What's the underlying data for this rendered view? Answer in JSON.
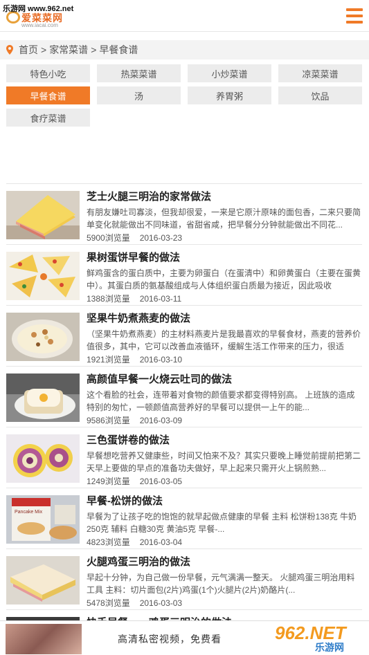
{
  "watermark": "乐游网 www.962.net",
  "logo": {
    "brand": "爱菜菜网",
    "domain": "www.iacai.com"
  },
  "breadcrumb": {
    "home": "首页",
    "sep1": ">",
    "level1": "家常菜谱",
    "sep2": ">",
    "level2": "早餐食谱"
  },
  "categories": [
    {
      "label": "特色小吃"
    },
    {
      "label": "热菜菜谱"
    },
    {
      "label": "小炒菜谱"
    },
    {
      "label": "凉菜菜谱"
    },
    {
      "label": "早餐食谱",
      "active": true
    },
    {
      "label": "汤"
    },
    {
      "label": "养胃粥"
    },
    {
      "label": "饮品"
    },
    {
      "label": "食疗菜谱"
    }
  ],
  "articles": [
    {
      "title": "芝士火腿三明治的家常做法",
      "desc": "有朋友嫌吐司寡淡，但我却很爱，一来是它原汁原味的面包香，二来只要简单变化就能做出不同味道，省甜省咸，把早餐分分钟就能做出不同花...",
      "views": "5900浏览量",
      "date": "2016-03-23"
    },
    {
      "title": "果树蛋饼早餐的做法",
      "desc": "鲜鸡蛋含的蛋白质中，主要为卵蛋白（在蛋清中）和卵黄蛋白（主要在蛋黄中）。其蛋白质的氨基酸组成与人体组织蛋白质最为接近，因此吸收",
      "views": "1388浏览量",
      "date": "2016-03-11"
    },
    {
      "title": "坚果牛奶煮燕麦的做法",
      "desc": "（坚果牛奶煮燕麦）的主材料燕麦片是我最喜欢的早餐食材，燕麦的营养价值很多，其中，它可以改善血液循环，缓解生活工作带来的压力，很适",
      "views": "1921浏览量",
      "date": "2016-03-10"
    },
    {
      "title": "高颜值早餐一火烧云吐司的做法",
      "desc": "这个看脸的社会，连带着对食物的颜值要求都变得特别高。 上班族的造成特别的匆忙，一顿颜值高营养好的早餐可以提供一上午的能...",
      "views": "9586浏览量",
      "date": "2016-03-09"
    },
    {
      "title": "三色蛋饼卷的做法",
      "desc": "早餐想吃营养又健康些，时间又怕来不及？其实只要晚上睡觉前提前把第二天早上要做的早点的准备功夫做好，早上起来只需开火上锅煎熟...",
      "views": "1249浏览量",
      "date": "2016-03-05"
    },
    {
      "title": "早餐-松饼的做法",
      "desc": "早餐为了让孩子吃的饱饱的就早起做点健康的早餐 主料 松饼粉138克 牛奶250克 辅料 白糖30克 黄油5克 早餐-...",
      "views": "4823浏览量",
      "date": "2016-03-04",
      "box_text": "Pancake Mix"
    },
    {
      "title": "火腿鸡蛋三明治的做法",
      "desc": "早起十分钟，为自己做一份早餐，元气满满一整天。 火腿鸡蛋三明治用料工具 主料：切片面包(2片)鸡蛋(1个)火腿片(2片)奶酪片(...",
      "views": "5478浏览量",
      "date": "2016-03-03"
    },
    {
      "title": "快手早餐——鸡蛋三明治的做法"
    }
  ],
  "ad": {
    "text": "高清私密视频，免费看",
    "logo_big": "962.NET",
    "logo_small": "乐游网"
  }
}
